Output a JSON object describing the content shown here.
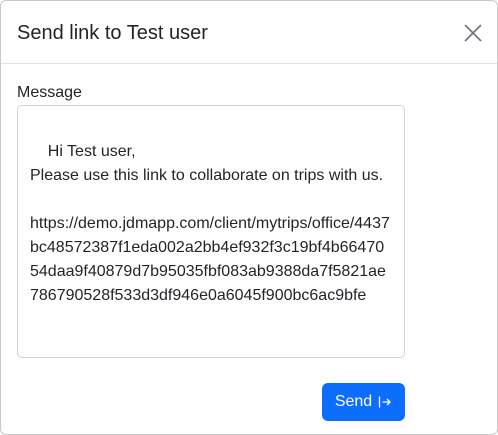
{
  "modal": {
    "title": "Send link to Test user",
    "close_icon": "close-icon"
  },
  "form": {
    "message_label": "Message",
    "message_value": "Hi Test user,\nPlease use this link to collaborate on trips with us.\n\nhttps://demo.jdmapp.com/client/mytrips/office/4437bc48572387f1eda002a2bb4ef932f3c19bf4b6647054daa9f40879d7b95035fbf083ab9388da7f5821ae786790528f533d3df946e0a6045f900bc6ac9bfe"
  },
  "footer": {
    "send_label": "Send",
    "send_icon": "send-icon"
  },
  "colors": {
    "primary": "#0d6efd",
    "border": "#dee2e6",
    "text": "#212529"
  }
}
